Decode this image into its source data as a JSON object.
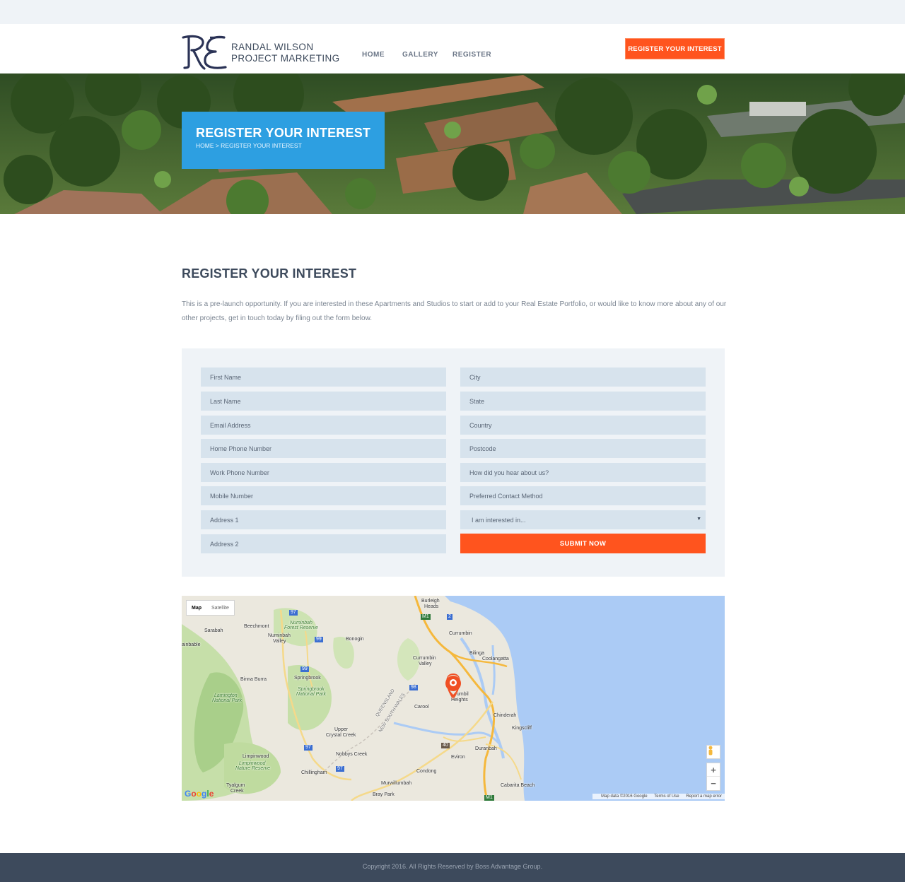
{
  "brand": {
    "line1": "RANDAL WILSON",
    "line2": "PROJECT MARKETING",
    "colors": {
      "navy": "#2b3356",
      "accent": "#ff541e",
      "hero_blue": "#2d9fe1",
      "text": "#3d4a5c"
    }
  },
  "nav": {
    "items": [
      "HOME",
      "GALLERY",
      "REGISTER"
    ]
  },
  "header_cta": "REGISTER YOUR INTEREST",
  "hero": {
    "title": "REGISTER YOUR INTEREST",
    "breadcrumb": "HOME > REGISTER YOUR INTEREST"
  },
  "main": {
    "title": "REGISTER YOUR INTEREST",
    "intro": "This is a pre-launch opportunity. If you are interested in these Apartments and Studios to start or add to your Real Estate Portfolio, or would like to know more about any of our other projects, get in touch today by filing out the form below."
  },
  "form": {
    "left": {
      "first_name": "First Name",
      "last_name": "Last Name",
      "email": "Email Address",
      "home_phone": "Home Phone Number",
      "work_phone": "Work Phone Number",
      "mobile": "Mobile Number",
      "address1": "Address 1",
      "address2": "Address 2"
    },
    "right": {
      "city": "City",
      "state": "State",
      "country": "Country",
      "postcode": "Postcode",
      "hear_about": "How did you hear about us?",
      "contact_method": "Preferred Contact Method",
      "interest_select": "I am interested in..."
    },
    "submit": "SUBMIT NOW"
  },
  "map": {
    "toggle": {
      "map": "Map",
      "satellite": "Satellite"
    },
    "zoom_in": "+",
    "zoom_out": "−",
    "google": "Google",
    "attribution": {
      "data": "Map data ©2016 Google",
      "terms": "Terms of Use",
      "report": "Report a map error"
    },
    "labels": {
      "burleigh1": "Burleigh",
      "burleigh2": "Heads",
      "sarabah": "Sarabah",
      "beechmont": "Beechmont",
      "numinbah_forest1": "Numinbah",
      "numinbah_forest2": "Forest Reserve",
      "numinbah_valley1": "Numinbah",
      "numinbah_valley2": "Valley",
      "bonogin": "Bonogin",
      "currumbin": "Currumbin",
      "rainbable": "ainbable",
      "bilinga": "Bilinga",
      "coolangatta": "Coolangatta",
      "currumbin_valley1": "Currumbin",
      "currumbin_valley2": "Valley",
      "binna_burra": "Binna Burra",
      "springbrook": "Springbrook",
      "springbrook_np1": "Springbrook",
      "springbrook_np2": "National Park",
      "lamington1": "Lamington",
      "lamington2": "National Park",
      "tumbulgum1": "umbil",
      "tumbulgum2": "Heights",
      "carool": "Carool",
      "qld": "QUEENSLAND",
      "nsw": "NEW SOUTH WALES",
      "chinderah": "Chinderah",
      "kingscliff": "Kingscliff",
      "upper_crystal1": "Upper",
      "upper_crystal2": "Crystal Creek",
      "duranbah": "Duranbah",
      "nobbys": "Nobbys Creek",
      "limpinwood": "Limpinwood",
      "limpinwood_nr1": "Limpinwood",
      "limpinwood_nr2": "Nature Reserve",
      "eviron": "Eviron",
      "chillingham": "Chillingham",
      "condong": "Condong",
      "murwillumbah": "Murwillumbah",
      "cabarita": "Cabarita Beach",
      "tyalgum1": "Tyalgum",
      "tyalgum2": "Creek",
      "bray_park": "Bray Park",
      "r97a": "97",
      "r97b": "97",
      "r97c": "97",
      "r99a": "99",
      "r99b": "99",
      "r98": "98",
      "r40": "40",
      "m1a": "M1",
      "m1b": "M1",
      "r2": "2"
    }
  },
  "footer": {
    "copyright": "Copyright 2016. All Rights Reserved by Boss Advantage Group."
  }
}
